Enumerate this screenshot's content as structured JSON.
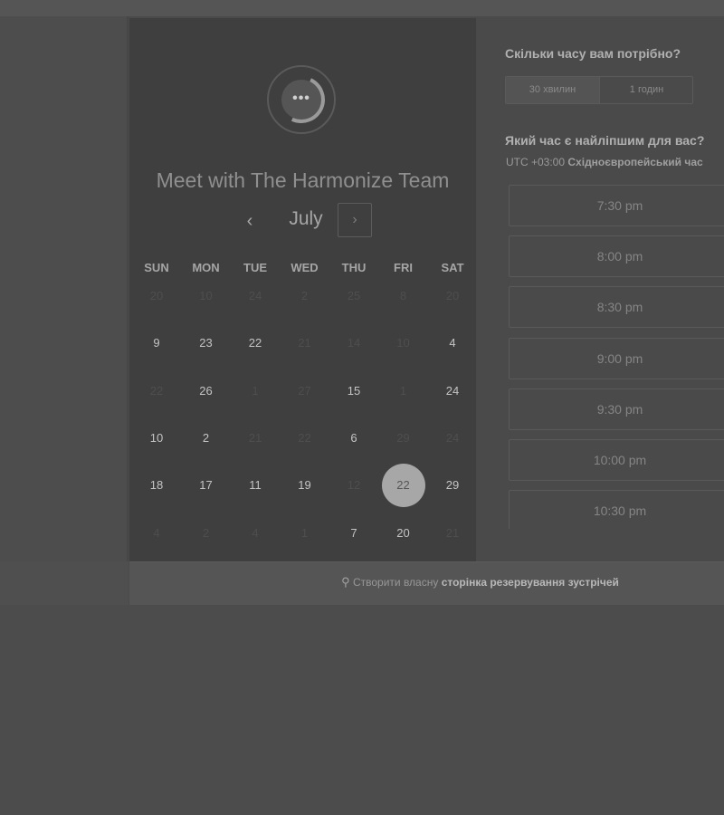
{
  "calendar": {
    "title": "Meet with The Harmonize Team",
    "month": "July",
    "prev_icon": "‹",
    "next_icon": "›",
    "weekdays": [
      "SUN",
      "MON",
      "TUE",
      "WED",
      "THU",
      "FRI",
      "SAT"
    ],
    "weeks": [
      [
        {
          "d": "20",
          "muted": true
        },
        {
          "d": "10",
          "muted": true
        },
        {
          "d": "24",
          "muted": true
        },
        {
          "d": "2",
          "muted": true
        },
        {
          "d": "25",
          "muted": true
        },
        {
          "d": "8",
          "muted": true
        },
        {
          "d": "20",
          "muted": true
        }
      ],
      [
        {
          "d": "9",
          "muted": false
        },
        {
          "d": "23",
          "muted": false
        },
        {
          "d": "22",
          "muted": false
        },
        {
          "d": "21",
          "muted": true
        },
        {
          "d": "14",
          "muted": true
        },
        {
          "d": "10",
          "muted": true
        },
        {
          "d": "4",
          "muted": false
        }
      ],
      [
        {
          "d": "22",
          "muted": true
        },
        {
          "d": "26",
          "muted": false
        },
        {
          "d": "1",
          "muted": true
        },
        {
          "d": "27",
          "muted": true
        },
        {
          "d": "15",
          "muted": false
        },
        {
          "d": "1",
          "muted": true
        },
        {
          "d": "24",
          "muted": false
        }
      ],
      [
        {
          "d": "10",
          "muted": false
        },
        {
          "d": "2",
          "muted": false
        },
        {
          "d": "21",
          "muted": true
        },
        {
          "d": "22",
          "muted": true
        },
        {
          "d": "6",
          "muted": false
        },
        {
          "d": "29",
          "muted": true
        },
        {
          "d": "24",
          "muted": true
        }
      ],
      [
        {
          "d": "18",
          "muted": false
        },
        {
          "d": "17",
          "muted": false
        },
        {
          "d": "11",
          "muted": false
        },
        {
          "d": "19",
          "muted": false
        },
        {
          "d": "12",
          "muted": true
        },
        {
          "d": "22",
          "muted": false,
          "selected": true
        },
        {
          "d": "29",
          "muted": false
        }
      ],
      [
        {
          "d": "4",
          "muted": true
        },
        {
          "d": "2",
          "muted": true
        },
        {
          "d": "4",
          "muted": true
        },
        {
          "d": "1",
          "muted": true
        },
        {
          "d": "7",
          "muted": false
        },
        {
          "d": "20",
          "muted": false
        },
        {
          "d": "21",
          "muted": true
        }
      ]
    ]
  },
  "logo": {
    "icon": "chat-bubble-icon",
    "dots": "•••"
  },
  "scheduler": {
    "duration_question": "Скільки часу вам потрібно?",
    "durations": [
      "30 хвилин",
      "1 годин"
    ],
    "time_question": "Який час є найліпшим для вас?",
    "timezone_offset": "UTC +03:00",
    "timezone_name": "Східноєвропейський час",
    "slots": [
      "7:30 pm",
      "8:00 pm",
      "8:30 pm",
      "9:00 pm",
      "9:30 pm",
      "10:00 pm",
      "10:30 pm"
    ]
  },
  "footer": {
    "icon": "hubspot-sprocket-icon",
    "icon_glyph": "⚲",
    "text_prefix": "Створити власну",
    "text_strong": "сторінка резервування зустрічей"
  }
}
